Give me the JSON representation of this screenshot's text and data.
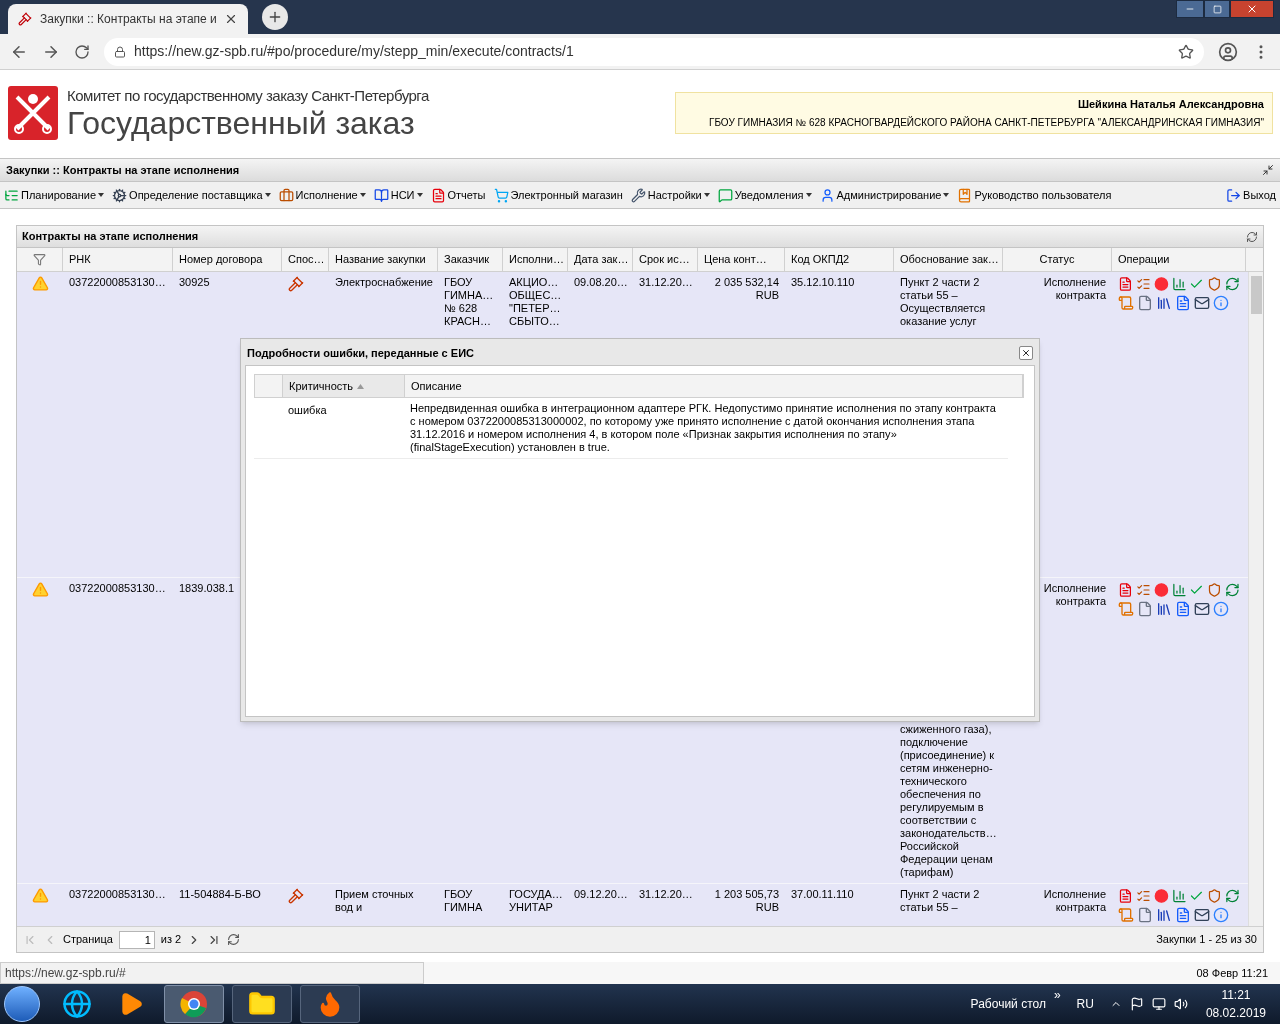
{
  "browser": {
    "tab_title": "Закупки :: Контракты на этапе и",
    "url": "https://new.gz-spb.ru/#po/procedure/my/stepp_min/execute/contracts/1"
  },
  "header": {
    "org_line": "Комитет по государственному заказу Санкт-Петербурга",
    "title": "Государственный заказ",
    "user_name": "Шейкина Наталья Александровна",
    "user_org": "ГБОУ ГИМНАЗИЯ № 628 КРАСНОГВАРДЕЙСКОГО РАЙОНА САНКТ-ПЕТЕРБУРГА \"АЛЕКСАНДРИНСКАЯ ГИМНАЗИЯ\""
  },
  "page_title": "Закупки :: Контракты на этапе исполнения",
  "menu": [
    {
      "label": "Планирование",
      "has_menu": true
    },
    {
      "label": "Определение поставщика",
      "has_menu": true
    },
    {
      "label": "Исполнение",
      "has_menu": true
    },
    {
      "label": "НСИ",
      "has_menu": true
    },
    {
      "label": "Отчеты",
      "has_menu": false
    },
    {
      "label": "Электронный магазин",
      "has_menu": false
    },
    {
      "label": "Настройки",
      "has_menu": true
    },
    {
      "label": "Уведомления",
      "has_menu": true
    },
    {
      "label": "Администрирование",
      "has_menu": true
    },
    {
      "label": "Руководство пользователя",
      "has_menu": false
    }
  ],
  "exit": "Выход",
  "grid": {
    "title": "Контракты на этапе исполнения",
    "columns": [
      "РНК",
      "Номер договора",
      "Спос…",
      "Название закупки",
      "Заказчик",
      "Исполни…",
      "Дата зак…",
      "Срок ис…",
      "Цена конт…",
      "Код ОКПД2",
      "Обоснование зак…",
      "Статус",
      "Операции"
    ],
    "rows": [
      {
        "warning": true,
        "covered": false,
        "rnk": "03722000853130…",
        "number": "30925",
        "method": true,
        "name": "Электроснабжение",
        "customer": "ГБОУ\nГИМНА…\n№ 628\nКРАСН…",
        "supplier": "АКЦИО…\nОБЩЕС…\n\"ПЕТЕР…\nСБЫТО…",
        "date": "09.08.20…",
        "end": "31.12.20…",
        "price": "2 035 532,14\nRUB",
        "okpd": "35.12.10.110",
        "basis": "Пункт 2 части 2\nстатьи 55 –\nОсуществляется\nоказание услуг",
        "status": "Исполнение\nконтракта",
        "operations": true
      },
      {
        "warning": true,
        "covered": true,
        "rnk": "03722000853130…",
        "number": "1839.038.1",
        "method": false,
        "basis": "сжиженного газа),\nподключение\n(присоединение) к\nсетям инженерно-\nтехнического\nобеспечения по\nрегулируемым в\nсоответствии с\nзаконодательств…\nРоссийской\nФедерации ценам\n(тарифам)",
        "status": "Исполнение\nконтракта",
        "operations": true
      },
      {
        "warning": true,
        "covered": false,
        "rnk": "03722000853130…",
        "number": "11-504884-Б-ВО",
        "method": true,
        "name": "Прием сточных\nвод и",
        "customer": "ГБОУ\nГИМНА",
        "supplier": "ГОСУДА…\nУНИТАР",
        "date": "09.12.20…",
        "end": "31.12.20…",
        "price": "1 203 505,73\nRUB",
        "okpd": "37.00.11.110",
        "basis": "Пункт 2 части 2\nстатьи 55 –",
        "status": "Исполнение\nконтракта",
        "operations": true
      }
    ]
  },
  "pager": {
    "page_label": "Страница",
    "page": "1",
    "of": "из 2",
    "summary": "Закупки 1 - 25 из 30"
  },
  "dialog": {
    "title": "Подробности ошибки, переданные с ЕИС",
    "columns": [
      {
        "label": "Критичность",
        "sorted": true
      },
      {
        "label": "Описание",
        "sorted": false
      }
    ],
    "rows": [
      {
        "severity": "ошибка",
        "description": "Непредвиденная ошибка в интеграционном адаптере РГК. Недопустимо принятие исполнения по этапу контракта с номером 0372200085313000002, по которому уже принято исполнение с датой окончания исполнения этапа 31.12.2016 и номером исполнения 4, в котором поле «Признак закрытия исполнения по этапу» (finalStageExecution) установлен в true."
      }
    ]
  },
  "status_bar": {
    "url": "https://new.gz-spb.ru/#",
    "time": "08 Февр 11:21"
  },
  "taskbar": {
    "desktop": "Рабочий стол",
    "chevron": "»",
    "lang": "RU",
    "time": "11:21",
    "date": "08.02.2019"
  }
}
